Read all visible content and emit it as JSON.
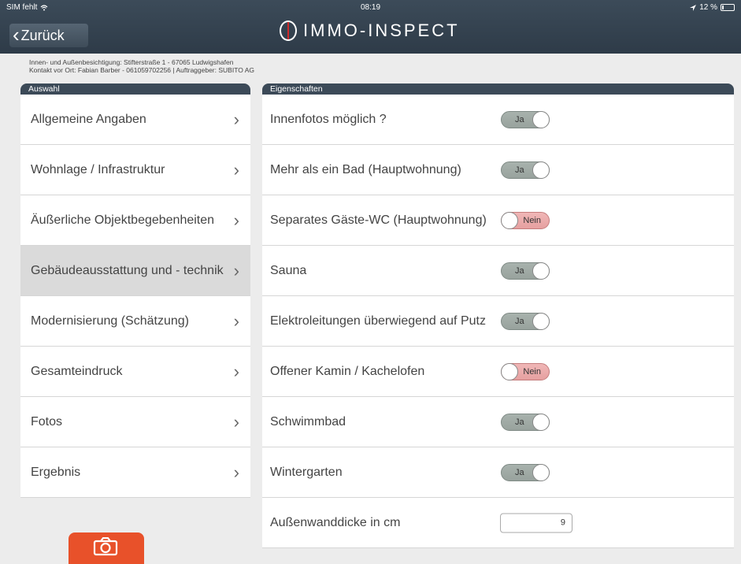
{
  "status": {
    "carrier": "SIM fehlt",
    "time": "08:19",
    "battery": "12 %"
  },
  "nav": {
    "back_label": "Zurück",
    "app_title": "IMMO-INSPECT"
  },
  "info": {
    "line1": "Innen- und Außenbesichtigung: Stifterstraße 1 - 67065 Ludwigshafen",
    "line2": "Kontakt vor Ort: Fabian Barber - 061059702256 | Auftraggeber: SUBITO AG"
  },
  "left_panel": {
    "title": "Auswahl",
    "items": [
      {
        "label": "Allgemeine Angaben"
      },
      {
        "label": "Wohnlage / Infrastruktur"
      },
      {
        "label": "Äußerliche Objektbegebenheiten"
      },
      {
        "label": "Gebäudeausstattung und - technik"
      },
      {
        "label": "Modernisierung (Schätzung)"
      },
      {
        "label": "Gesamteindruck"
      },
      {
        "label": "Fotos"
      },
      {
        "label": "Ergebnis"
      }
    ],
    "selected_index": 3
  },
  "right_panel": {
    "title": "Eigenschaften",
    "items": [
      {
        "label": "Innenfotos möglich ?",
        "value": "Ja"
      },
      {
        "label": "Mehr als ein Bad (Hauptwohnung)",
        "value": "Ja"
      },
      {
        "label": "Separates Gäste-WC (Hauptwohnung)",
        "value": "Nein"
      },
      {
        "label": "Sauna",
        "value": "Ja"
      },
      {
        "label": "Elektroleitungen überwiegend auf Putz",
        "value": "Ja"
      },
      {
        "label": "Offener Kamin / Kachelofen",
        "value": "Nein"
      },
      {
        "label": "Schwimmbad",
        "value": "Ja"
      },
      {
        "label": "Wintergarten",
        "value": "Ja"
      },
      {
        "label": "Außenwanddicke in cm",
        "input_value": "9"
      }
    ]
  },
  "icons": {
    "back": "chevron-left-icon",
    "arrow": "chevron-right-icon",
    "camera": "camera-icon",
    "wifi": "wifi-icon",
    "location": "location-arrow-icon",
    "battery": "battery-icon"
  },
  "colors": {
    "header": "#2e3b48",
    "toggle_on": "#a8b2ad",
    "toggle_off": "#f0b7b7",
    "camera_button": "#e8512a",
    "logo_accent": "#d02a2a"
  }
}
